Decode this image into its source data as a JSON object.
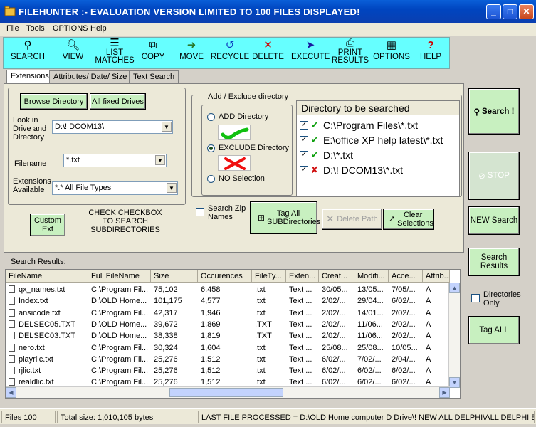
{
  "window": {
    "title": "FILEHUNTER :- EVALUATION VERSION LIMITED TO 100 FILES DISPLAYED!"
  },
  "menu": [
    "File",
    "Tools",
    "OPTIONS",
    "Help"
  ],
  "toolbar": [
    {
      "label": "SEARCH",
      "icon": "binoculars-icon"
    },
    {
      "label": "VIEW",
      "icon": "magnifier-icon"
    },
    {
      "label": "LIST MATCHES",
      "icon": "list-icon"
    },
    {
      "label": "COPY",
      "icon": "copy-icon"
    },
    {
      "label": "MOVE",
      "icon": "move-icon"
    },
    {
      "label": "RECYCLE",
      "icon": "recycle-icon"
    },
    {
      "label": "DELETE",
      "icon": "delete-icon"
    },
    {
      "label": "EXECUTE",
      "icon": "execute-icon"
    },
    {
      "label": "PRINT RESULTS",
      "icon": "printer-icon"
    },
    {
      "label": "OPTIONS",
      "icon": "options-icon"
    },
    {
      "label": "HELP",
      "icon": "help-icon"
    }
  ],
  "tabs": [
    "Extensions",
    "Attributes/ Date/ Size",
    "Text Search"
  ],
  "extensions": {
    "browse_label": "Browse Directory",
    "all_drives_label": "All fixed Drives",
    "look_in_label": "Look in Drive and Directory",
    "look_in_value": "D:\\! DCOM13\\",
    "filename_label": "Filename",
    "filename_value": "*.txt",
    "ext_label": "Extensions Available",
    "ext_value": "*.* All File Types",
    "custom_ext_label": "Custom Ext",
    "check_note": "CHECK CHECKBOX TO SEARCH SUBDIRECTORIES"
  },
  "add_exclude": {
    "title": "Add / Exclude directory",
    "add_label": "ADD Directory",
    "exclude_label": "EXCLUDE Directory",
    "none_label": "NO Selection",
    "selected": "exclude"
  },
  "directory_list": {
    "title": "Directory to be searched",
    "items": [
      {
        "path": "C:\\Program Files\\*.txt",
        "mark": "✔",
        "checked": true
      },
      {
        "path": "E:\\office XP help latest\\*.txt",
        "mark": "✔",
        "checked": true
      },
      {
        "path": "D:\\*.txt",
        "mark": "✔",
        "checked": true
      },
      {
        "path": "D:\\! DCOM13\\*.txt",
        "mark": "✘",
        "checked": true
      }
    ]
  },
  "search_zip_label": "Search Zip Names",
  "tag_all_sub_label": "Tag All SUBDirectories",
  "delete_path_label": "Delete Path",
  "clear_selections_label": "Clear Selections",
  "right": {
    "search_label": "Search !",
    "stop_label": "STOP",
    "new_search_label": "NEW Search",
    "search_results_label": "Search Results",
    "dirs_only_label": "Directories Only",
    "tag_all_label": "Tag ALL"
  },
  "results": {
    "label": "Search Results:",
    "columns": [
      "FileName",
      "Full FileName",
      "Size",
      "Occurences",
      "FileTy...",
      "Exten...",
      "Creat...",
      "Modifi...",
      "Acce...",
      "Attrib..."
    ],
    "rows": [
      [
        "qx_names.txt",
        "C:\\Program Fil...",
        "75,102",
        "6,458",
        ".txt",
        "Text ...",
        "30/05...",
        "13/05...",
        "7/05/...",
        "A"
      ],
      [
        "Index.txt",
        "D:\\OLD Home...",
        "101,175",
        "4,577",
        ".txt",
        "Text ...",
        "2/02/...",
        "29/04...",
        "6/02/...",
        "A"
      ],
      [
        "ansicode.txt",
        "C:\\Program Fil...",
        "42,317",
        "1,946",
        ".txt",
        "Text ...",
        "2/02/...",
        "14/01...",
        "2/02/...",
        "A"
      ],
      [
        "DELSEC05.TXT",
        "D:\\OLD Home...",
        "39,672",
        "1,869",
        ".TXT",
        "Text ...",
        "2/02/...",
        "11/06...",
        "2/02/...",
        "A"
      ],
      [
        "DELSEC03.TXT",
        "D:\\OLD Home...",
        "38,338",
        "1,819",
        ".TXT",
        "Text ...",
        "2/02/...",
        "11/06...",
        "2/02/...",
        "A"
      ],
      [
        "nero.txt",
        "C:\\Program Fil...",
        "30,324",
        "1,604",
        ".txt",
        "Text ...",
        "25/08...",
        "25/08...",
        "10/05...",
        "A"
      ],
      [
        "playrlic.txt",
        "C:\\Program Fil...",
        "25,276",
        "1,512",
        ".txt",
        "Text ...",
        "6/02/...",
        "7/02/...",
        "2/04/...",
        "A"
      ],
      [
        "rjlic.txt",
        "C:\\Program Fil...",
        "25,276",
        "1,512",
        ".txt",
        "Text ...",
        "6/02/...",
        "6/02/...",
        "6/02/...",
        "A"
      ],
      [
        "realdlic.txt",
        "C:\\Program Fil...",
        "25,276",
        "1,512",
        ".txt",
        "Text ...",
        "6/02/...",
        "6/02/...",
        "6/02/...",
        "A"
      ]
    ]
  },
  "status": {
    "files": "Files 100",
    "total": "Total size: 1,010,105 bytes",
    "last": "LAST FILE PROCESSED  =  D:\\OLD Home computer D Drive\\! NEW ALL DELPHI\\ALL DELPHI BOOK"
  }
}
